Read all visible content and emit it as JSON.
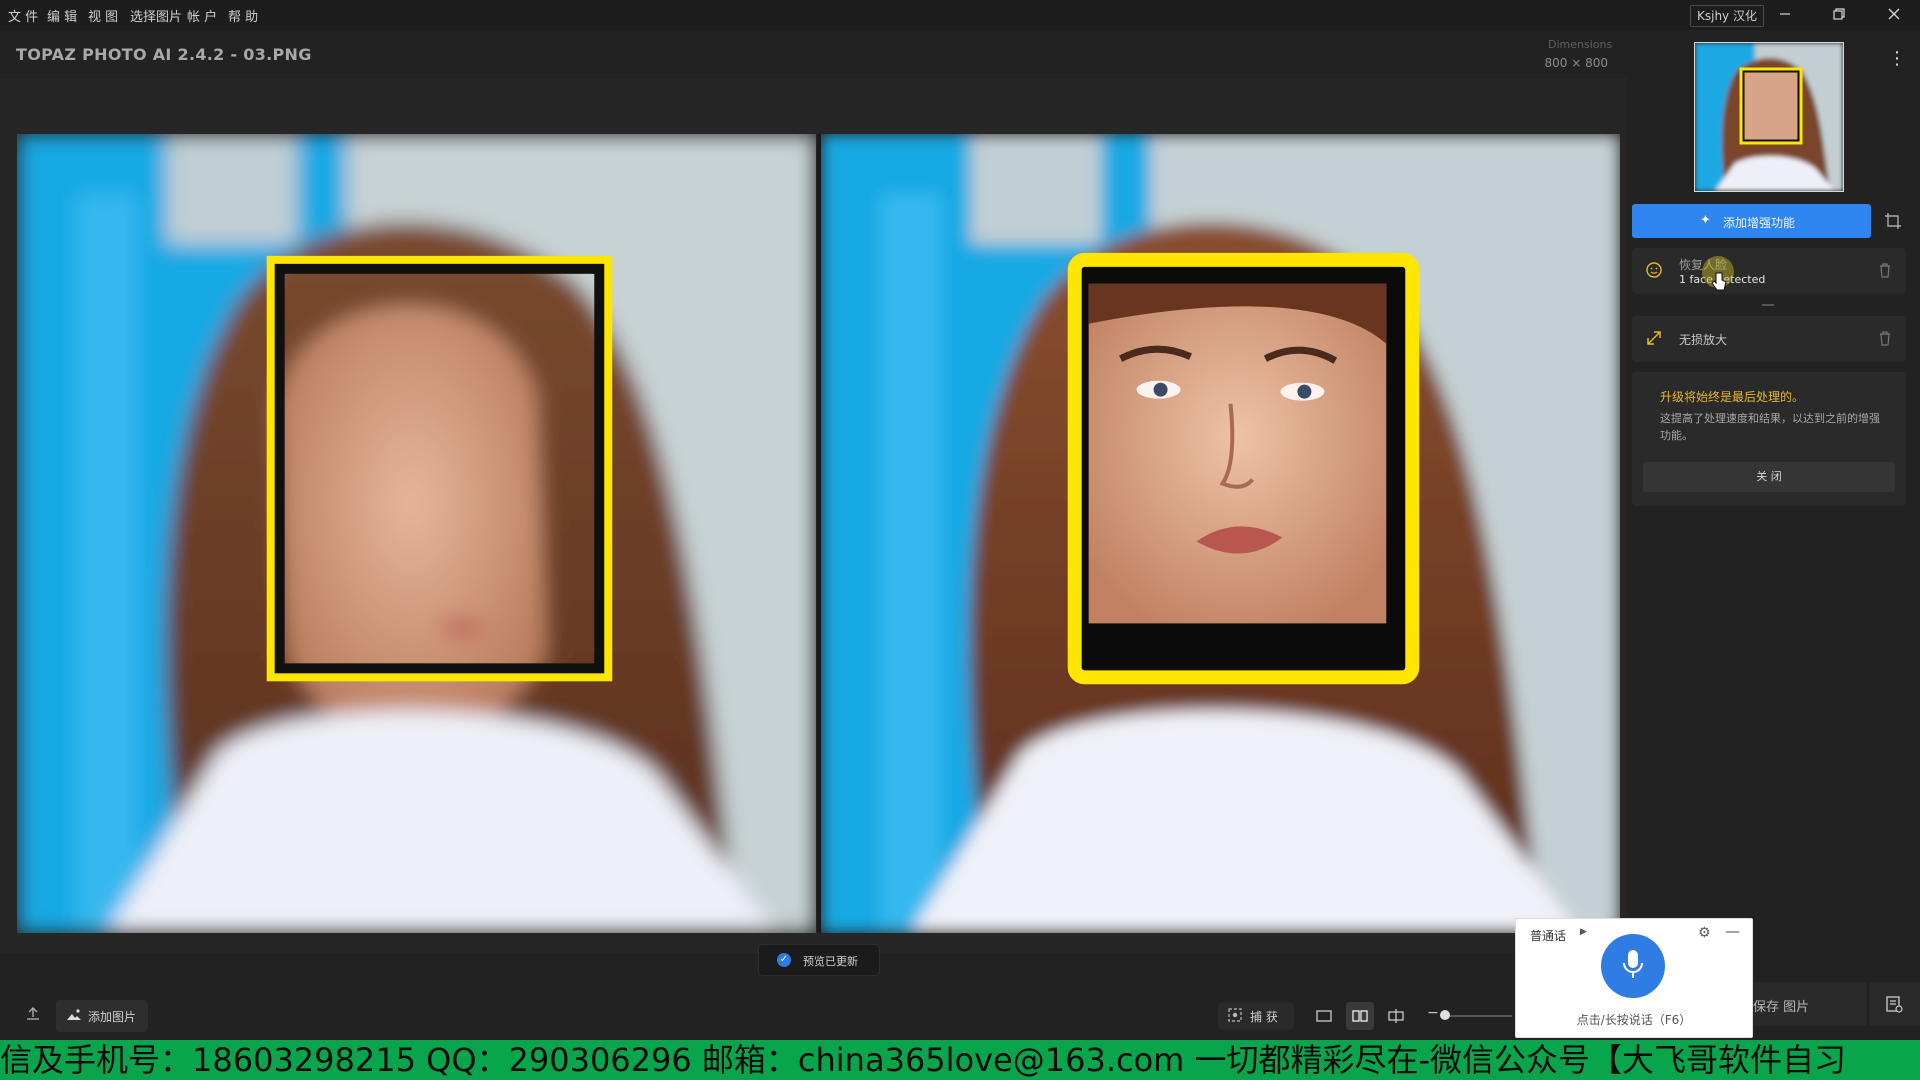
{
  "menu": {
    "items": [
      "文 件",
      "编 辑",
      "视 图",
      "选择图片",
      "帐 户",
      "帮 助"
    ],
    "translator_badge": "Ksjhy 汉化"
  },
  "header": {
    "app_title": "TOPAZ PHOTO AI 2.4.2 - 03.PNG",
    "dimensions_label": "Dimensions",
    "dimensions_value": "800 × 800"
  },
  "status": {
    "preview_updated": "预览已更新"
  },
  "toolbar": {
    "add_image": "添加图片",
    "capture": "捕 获"
  },
  "sidebar": {
    "add_enhancement": "添加增强功能",
    "face_recovery": {
      "title": "恢复人脸",
      "subtitle": "1 face detected"
    },
    "upscale": {
      "title": "无损放大"
    },
    "info": {
      "heading": "升级将始终是最后处理的。",
      "body": "这提高了处理速度和结果，以达到之前的增强功能。",
      "close": "关 闭"
    },
    "save_image": "保存 图片"
  },
  "voice_widget": {
    "language": "普通话",
    "hint": "点击/长按说话（F6）"
  },
  "banner": {
    "text": "信及手机号：18603298215 QQ：290306296 邮箱：china365love@163.com 一切都精彩尽在-微信公众号【大飞哥软件自习"
  },
  "colors": {
    "accent_blue": "#2f86ee",
    "face_box_yellow": "#ffe600",
    "warning_text": "#e7b730",
    "banner_green": "#08a54d"
  }
}
